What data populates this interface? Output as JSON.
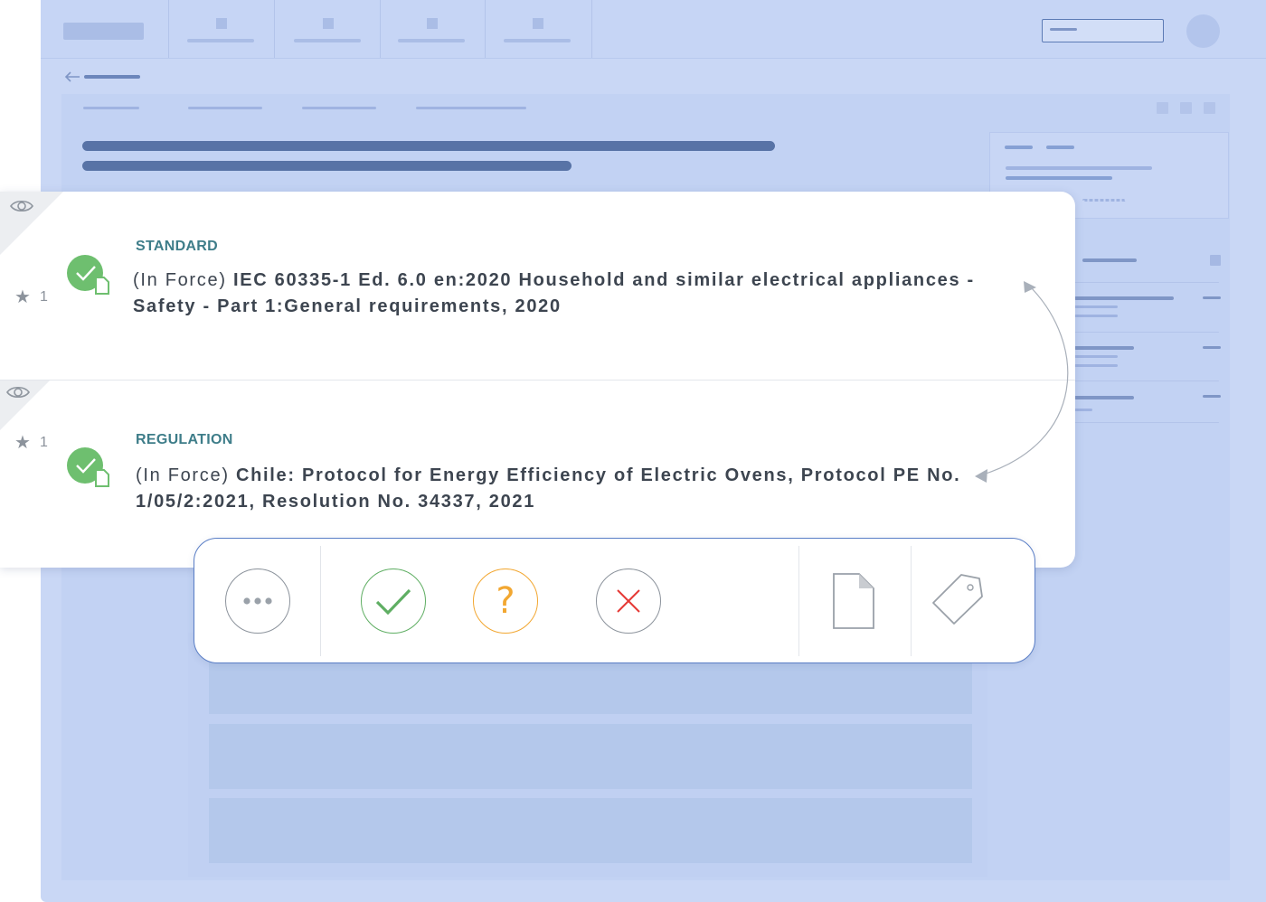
{
  "items": [
    {
      "category": "STANDARD",
      "status_prefix": "(In Force)",
      "title": "IEC 60335-1 Ed. 6.0 en:2020 Household and similar electrical appliances - Safety - Part 1:General requirements, 2020",
      "star_count": "1",
      "status_icon": "check-icon"
    },
    {
      "category": "REGULATION",
      "status_prefix": "(In Force)",
      "title": "Chile: Protocol for Energy Efficiency of Electric Ovens, Protocol PE No. 1/05/2:2021, Resolution No. 34337, 2021",
      "star_count": "1",
      "status_icon": "check-icon"
    }
  ],
  "toolbar": {
    "more_icon": "more-dots-icon",
    "approve_icon": "check-icon",
    "question_label": "?",
    "reject_icon": "close-icon",
    "document_icon": "document-icon",
    "tag_icon": "tag-icon"
  },
  "colors": {
    "accent_teal": "#3e7d89",
    "success_green": "#6ebf6f",
    "warning_orange": "#f2a731",
    "danger_red": "#e53935",
    "background_blue": "#c9d7f5",
    "toolbar_border": "#5a7ec6"
  }
}
